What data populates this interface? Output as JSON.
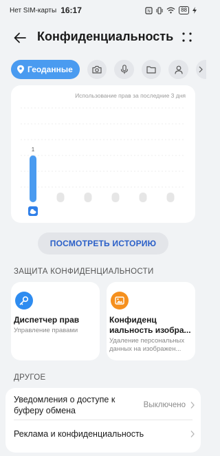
{
  "status_bar": {
    "carrier": "Нет SIM-карты",
    "time": "16:17",
    "battery": "88"
  },
  "header": {
    "title": "Конфиденциальность"
  },
  "filters": {
    "active_label": "Геоданные",
    "items": [
      "location-icon",
      "camera-icon",
      "microphone-icon",
      "folder-icon",
      "contacts-icon"
    ]
  },
  "chart_data": {
    "type": "bar",
    "caption": "Использование прав за последние 3 дня",
    "values": [
      1,
      0,
      0,
      0,
      0,
      0
    ],
    "value_label": "1",
    "bar_color": "#4a9bf0",
    "empty_color": "#e6e6e6"
  },
  "history_button": "ПОСМОТРЕТЬ ИСТОРИЮ",
  "sections": {
    "privacy": "ЗАЩИТА КОНФИДЕНЦИАЛЬНОСТИ",
    "other": "ДРУГОЕ"
  },
  "cards": [
    {
      "title": "Диспетчер прав",
      "subtitle": "Управление правами",
      "color": "#2e8cf0"
    },
    {
      "title": "Конфиденц иальность изобра...",
      "subtitle": "Удаление персональных данных на изображен...",
      "color": "#f5901e"
    }
  ],
  "list": [
    {
      "label": "Уведомления о доступе к буферу обмена",
      "value": "Выключено"
    },
    {
      "label": "Реклама и конфиденциальность",
      "value": ""
    }
  ]
}
